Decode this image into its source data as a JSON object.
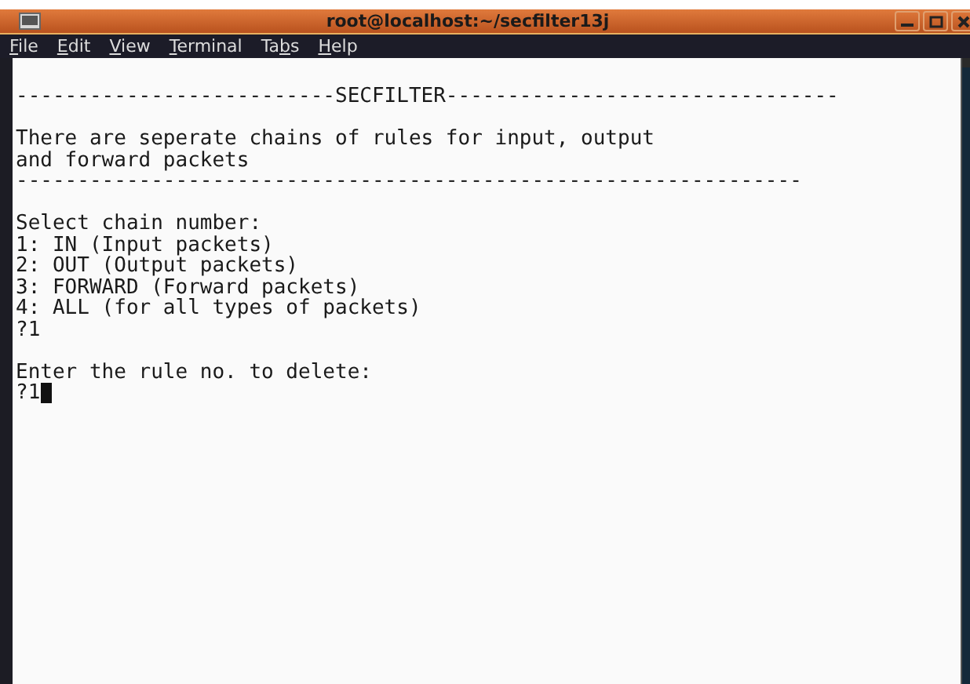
{
  "window": {
    "title": "root@localhost:~/secfilter13j"
  },
  "menu": [
    {
      "parts": [
        {
          "text": "F",
          "underlined": true
        },
        {
          "text": "ile",
          "underlined": false
        }
      ]
    },
    {
      "parts": [
        {
          "text": "E",
          "underlined": true
        },
        {
          "text": "dit",
          "underlined": false
        }
      ]
    },
    {
      "parts": [
        {
          "text": "V",
          "underlined": true
        },
        {
          "text": "iew",
          "underlined": false
        }
      ]
    },
    {
      "parts": [
        {
          "text": "T",
          "underlined": true
        },
        {
          "text": "erminal",
          "underlined": false
        }
      ]
    },
    {
      "parts": [
        {
          "text": "Ta",
          "underlined": false
        },
        {
          "text": "b",
          "underlined": true
        },
        {
          "text": "s",
          "underlined": false
        }
      ]
    },
    {
      "parts": [
        {
          "text": "H",
          "underlined": true
        },
        {
          "text": "elp",
          "underlined": false
        }
      ]
    }
  ],
  "terminal": {
    "cursor_visible": true,
    "blocks": [
      [
        "--------------------------SECFILTER--------------------------------"
      ],
      [
        "There are seperate chains of rules for input, output",
        "and forward packets",
        "----------------------------------------------------------------"
      ],
      [
        "Select chain number:",
        "1: IN (Input packets)",
        "2: OUT (Output packets)",
        "3: FORWARD (Forward packets)",
        "4: ALL (for all types of packets)",
        "?1"
      ],
      [
        "Enter the rule no. to delete:",
        "?1"
      ]
    ]
  }
}
